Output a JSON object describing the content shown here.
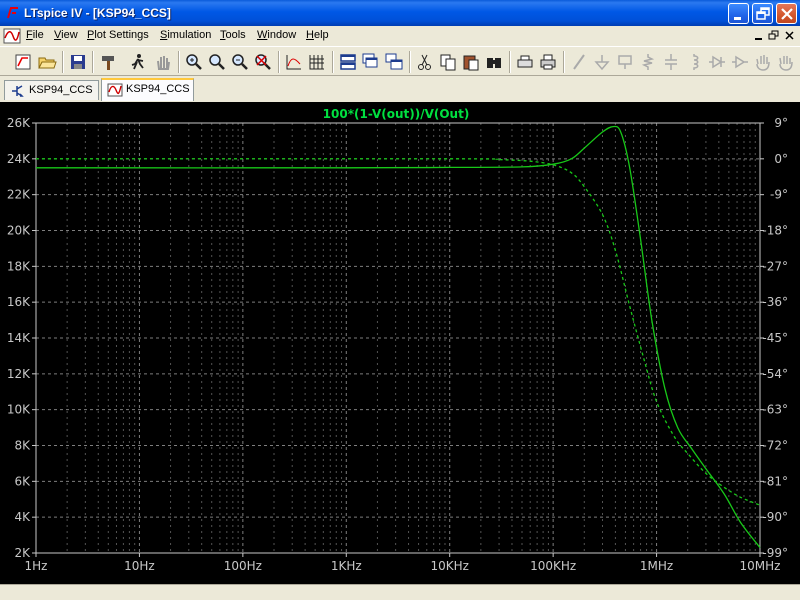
{
  "window": {
    "title": "LTspice IV - [KSP94_CCS]",
    "app_icon": "ltspice-logo-icon"
  },
  "menu": {
    "items": [
      {
        "label": "File",
        "underline": "F",
        "rest": "ile"
      },
      {
        "label": "View",
        "underline": "V",
        "rest": "iew"
      },
      {
        "label": "Plot Settings",
        "underline": "P",
        "rest": "lot Settings"
      },
      {
        "label": "Simulation",
        "underline": "S",
        "rest": "imulation"
      },
      {
        "label": "Tools",
        "underline": "T",
        "rest": "ools"
      },
      {
        "label": "Window",
        "underline": "W",
        "rest": "indow"
      },
      {
        "label": "Help",
        "underline": "H",
        "rest": "elp"
      }
    ]
  },
  "tabs": [
    {
      "label": "KSP94_CCS",
      "icon": "schematic-icon",
      "active": false
    },
    {
      "label": "KSP94_CCS",
      "icon": "waveform-icon",
      "active": true
    }
  ],
  "colors": {
    "trace": "#18C818",
    "grid": "#8C8C8C",
    "axis": "#C8C8C8",
    "title": "#00E040",
    "background": "#000000"
  },
  "chart_data": {
    "type": "line",
    "title": "100*(1-V(out))/V(Out)",
    "x_scale": "log",
    "x_range": [
      "1Hz",
      "10MHz"
    ],
    "x_ticks": [
      "1Hz",
      "10Hz",
      "100Hz",
      "1KHz",
      "10KHz",
      "100KHz",
      "1MHz",
      "10MHz"
    ],
    "y_left_ticks": [
      "26K",
      "24K",
      "22K",
      "20K",
      "18K",
      "16K",
      "14K",
      "12K",
      "10K",
      "8K",
      "6K",
      "4K",
      "2K"
    ],
    "y_left_range": [
      2000,
      26000
    ],
    "y_right_ticks": [
      "9°",
      "0°",
      "-9°",
      "-18°",
      "-27°",
      "-36°",
      "-45°",
      "-54°",
      "-63°",
      "-72°",
      "-81°",
      "-90°",
      "-99°"
    ],
    "y_right_range": [
      -99,
      9
    ],
    "grid": true,
    "series": [
      {
        "style": "solid",
        "axis": "left",
        "points": [
          {
            "f": 1,
            "v": 23500
          },
          {
            "f": 1000,
            "v": 23500
          },
          {
            "f": 10000,
            "v": 23520
          },
          {
            "f": 50000,
            "v": 23550
          },
          {
            "f": 100000,
            "v": 23700
          },
          {
            "f": 150000,
            "v": 24000
          },
          {
            "f": 200000,
            "v": 24600
          },
          {
            "f": 300000,
            "v": 25500
          },
          {
            "f": 380000,
            "v": 25800
          },
          {
            "f": 450000,
            "v": 25500
          },
          {
            "f": 550000,
            "v": 23500
          },
          {
            "f": 700000,
            "v": 19500
          },
          {
            "f": 900000,
            "v": 15000
          },
          {
            "f": 1200000,
            "v": 11200
          },
          {
            "f": 1600000,
            "v": 9000
          },
          {
            "f": 2200000,
            "v": 7800
          },
          {
            "f": 3000000,
            "v": 6700
          },
          {
            "f": 4500000,
            "v": 5300
          },
          {
            "f": 6500000,
            "v": 3700
          },
          {
            "f": 10000000,
            "v": 2300
          }
        ]
      },
      {
        "style": "dashed",
        "axis": "right",
        "points": [
          {
            "f": 1,
            "v": 0
          },
          {
            "f": 10000,
            "v": 0
          },
          {
            "f": 30000,
            "v": -0.2
          },
          {
            "f": 60000,
            "v": -0.6
          },
          {
            "f": 100000,
            "v": -1.5
          },
          {
            "f": 150000,
            "v": -3.5
          },
          {
            "f": 200000,
            "v": -7
          },
          {
            "f": 300000,
            "v": -14
          },
          {
            "f": 400000,
            "v": -23
          },
          {
            "f": 550000,
            "v": -37
          },
          {
            "f": 750000,
            "v": -50
          },
          {
            "f": 1000000,
            "v": -61
          },
          {
            "f": 1500000,
            "v": -70
          },
          {
            "f": 2000000,
            "v": -74
          },
          {
            "f": 3000000,
            "v": -79
          },
          {
            "f": 4500000,
            "v": -82.5
          },
          {
            "f": 6500000,
            "v": -85
          },
          {
            "f": 10000000,
            "v": -87
          }
        ]
      }
    ]
  }
}
